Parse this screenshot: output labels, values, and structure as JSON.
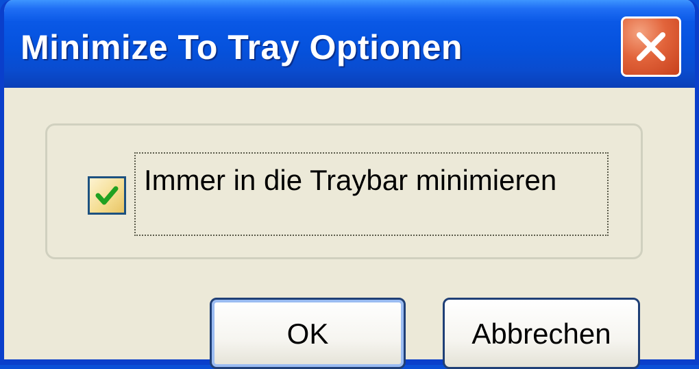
{
  "window": {
    "title": "Minimize To Tray Optionen"
  },
  "option": {
    "checked": true,
    "label": "Immer in die Traybar minimieren"
  },
  "buttons": {
    "ok_label": "OK",
    "cancel_label": "Abbrechen"
  },
  "icons": {
    "close": "close-icon",
    "check": "checkmark-icon"
  },
  "colors": {
    "titlebar": "#0552dd",
    "close_button": "#e2643b",
    "dialog_background": "#ece9d8",
    "checkmark": "#21a121"
  }
}
